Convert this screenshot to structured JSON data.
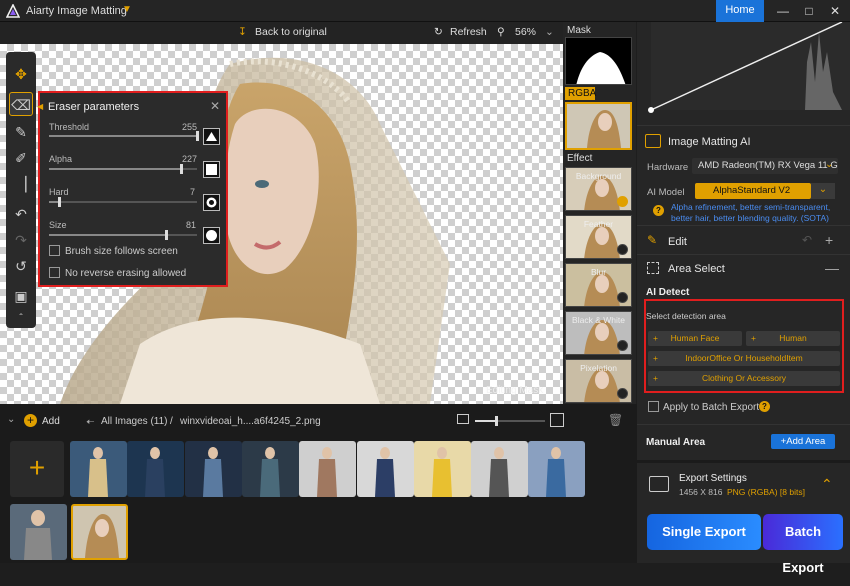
{
  "app": {
    "title": "Aiarty Image Matting",
    "home": "Home"
  },
  "toolbar": {
    "back": "Back to original",
    "refresh": "Refresh",
    "zoom": "56%"
  },
  "canvas": {
    "watermark": "Editing Mask"
  },
  "eraser": {
    "title": "Eraser parameters",
    "params": [
      {
        "label": "Threshold",
        "value": "255",
        "fraction": 1.0
      },
      {
        "label": "Alpha",
        "value": "227",
        "fraction": 0.89
      },
      {
        "label": "Hard",
        "value": "7",
        "fraction": 0.07
      },
      {
        "label": "Size",
        "value": "81",
        "fraction": 0.79
      }
    ],
    "brush_follow": "Brush size follows screen",
    "no_reverse": "No reverse erasing allowed"
  },
  "maskcol": {
    "mask": "Mask",
    "rgba": "RGBA",
    "effect": "Effect",
    "effects": [
      {
        "label": "Background",
        "active": true
      },
      {
        "label": "Feather",
        "active": false
      },
      {
        "label": "Blur",
        "active": false
      },
      {
        "label": "Black & White",
        "active": false
      },
      {
        "label": "Pixelation",
        "active": false
      }
    ]
  },
  "right": {
    "matting_title": "Image Matting AI",
    "hardware_label": "Hardware",
    "hardware_value": "AMD Radeon(TM) RX Vega 11 G",
    "ai_model_label": "AI Model",
    "ai_model_value": "AlphaStandard  V2",
    "model_note": "Alpha refinement, better semi-transparent, better hair, better blending quality. (SOTA)",
    "edit": "Edit",
    "area_select": "Area Select",
    "ai_detect": "AI Detect",
    "select_detection": "Select detection area",
    "detect_buttons": [
      "Human Face",
      "Human",
      "IndoorOffice Or HouseholdItem",
      "Clothing Or Accessory"
    ],
    "apply_batch": "Apply to Batch Export",
    "manual_area": "Manual Area",
    "add_area": "Add Area",
    "export_settings": "Export Settings",
    "export_info_size": "1456 X 816",
    "export_info_format": "PNG (RGBA) [8 bits]",
    "single_export": "Single Export",
    "batch_export": "Batch Export"
  },
  "bottom": {
    "add": "Add",
    "all_images": "All Images (11)",
    "separator": "/",
    "filename": "winxvideoai_h....a6f4245_2.png"
  },
  "colors": {
    "accent": "#e0a000",
    "blue": "#1a73d9",
    "highlight": "#e01e1e"
  }
}
